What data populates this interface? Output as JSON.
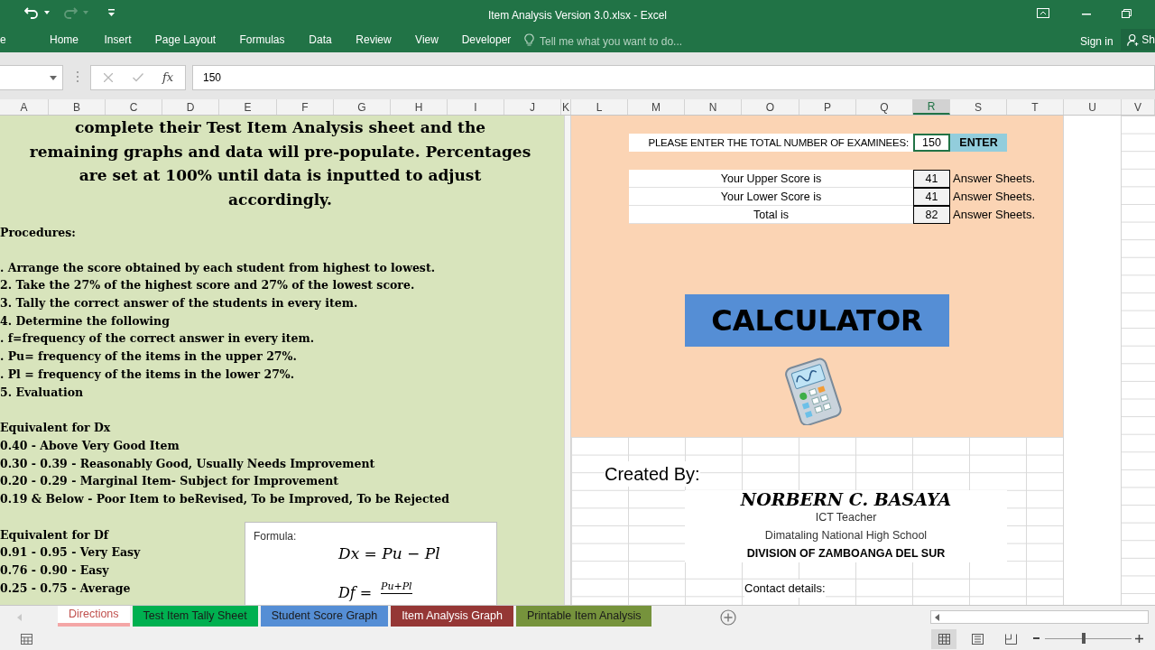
{
  "window": {
    "title": "Item Analysis Version 3.0.xlsx - Excel"
  },
  "ribbon_tabs": [
    {
      "label": "e"
    },
    {
      "label": "Home"
    },
    {
      "label": "Insert"
    },
    {
      "label": "Page Layout"
    },
    {
      "label": "Formulas"
    },
    {
      "label": "Data"
    },
    {
      "label": "Review"
    },
    {
      "label": "View"
    },
    {
      "label": "Developer"
    }
  ],
  "tell_me": {
    "placeholder": "Tell me what you want to do..."
  },
  "sign_in": "Sign in",
  "share": "Sh",
  "formula_bar": {
    "function_label": "fx",
    "value": "150"
  },
  "columns": [
    {
      "label": "A",
      "selected": false
    },
    {
      "label": "B",
      "selected": false
    },
    {
      "label": "C",
      "selected": false
    },
    {
      "label": "D",
      "selected": false
    },
    {
      "label": "E",
      "selected": false
    },
    {
      "label": "F",
      "selected": false
    },
    {
      "label": "G",
      "selected": false
    },
    {
      "label": "H",
      "selected": false
    },
    {
      "label": "I",
      "selected": false
    },
    {
      "label": "J",
      "selected": false
    },
    {
      "label": "K",
      "selected": false
    },
    {
      "label": "L",
      "selected": false
    },
    {
      "label": "M",
      "selected": false
    },
    {
      "label": "N",
      "selected": false
    },
    {
      "label": "O",
      "selected": false
    },
    {
      "label": "P",
      "selected": false
    },
    {
      "label": "Q",
      "selected": false
    },
    {
      "label": "R",
      "selected": true
    },
    {
      "label": "S",
      "selected": false
    },
    {
      "label": "T",
      "selected": false
    },
    {
      "label": "U",
      "selected": false
    },
    {
      "label": "V",
      "selected": false
    }
  ],
  "directions": {
    "intro_lines": [
      "complete their Test Item Analysis sheet and the",
      "remaining graphs and data will pre-populate. Percentages",
      "are set at 100% until data is inputted to adjust",
      "accordingly."
    ],
    "procedures_heading": "Procedures:",
    "procedures": [
      ". Arrange the score obtained by each student from highest to lowest.",
      "2. Take the 27% of the highest score and 27% of the lowest score.",
      "3. Tally the correct answer of the students in every item.",
      "4. Determine the following",
      ". f=frequency of the correct answer in every item.",
      ". Pu= frequency of the items in the upper 27%.",
      ". Pl = frequency of the items in the lower 27%.",
      "5. Evaluation"
    ],
    "dx_heading": "Equivalent for Dx",
    "dx_items": [
      "0.40 - Above Very Good Item",
      "0.30 - 0.39 - Reasonably Good, Usually Needs Improvement",
      "0.20 - 0.29 - Marginal Item- Subject for Improvement",
      "0.19 & Below - Poor Item to beRevised, To be Improved, To be Rejected"
    ],
    "df_heading": "Equivalent for Df",
    "df_items": [
      "0.91 - 0.95 - Very Easy",
      "0.76 - 0.90 - Easy",
      "0.25 - 0.75 - Average"
    ]
  },
  "formula_box": {
    "label": "Formula:",
    "dx": "Dx = Pu − Pl",
    "df": "Df =",
    "df_numerator": "Pu+Pl"
  },
  "calculator": {
    "prompt": "PLEASE ENTER THE TOTAL NUMBER OF EXAMINEES:",
    "examinees": "150",
    "enter_button": "ENTER",
    "results": [
      {
        "label": "Your Upper Score is",
        "value": "41",
        "unit": "Answer Sheets."
      },
      {
        "label": "Your Lower Score is",
        "value": "41",
        "unit": "Answer Sheets."
      },
      {
        "label": "Total is",
        "value": "82",
        "unit": "Answer Sheets."
      }
    ],
    "banner": "CALCULATOR"
  },
  "credits": {
    "heading": "Created By:",
    "name": "NORBERN C. BASAYA",
    "lines": [
      {
        "text": "ICT Teacher",
        "bold": false
      },
      {
        "text": "Dimataling National High School",
        "bold": false
      },
      {
        "text": "DIVISION OF ZAMBOANGA DEL SUR",
        "bold": true
      }
    ],
    "contact": "Contact details:"
  },
  "sheet_tabs": [
    {
      "label": "Directions",
      "color": "#f4a6a6",
      "selected": true
    },
    {
      "label": "Test Item Tally Sheet",
      "color": "#00b050",
      "selected": false
    },
    {
      "label": "Student Score Graph",
      "color": "#558ed5",
      "selected": false
    },
    {
      "label": "Item Analysis Graph",
      "color": "#953735",
      "selected": false
    },
    {
      "label": "Printable Item Analysis",
      "color": "#76933c",
      "selected": false
    }
  ],
  "status_bar": {
    "zoom_slider": {
      "level": 0.45
    }
  }
}
